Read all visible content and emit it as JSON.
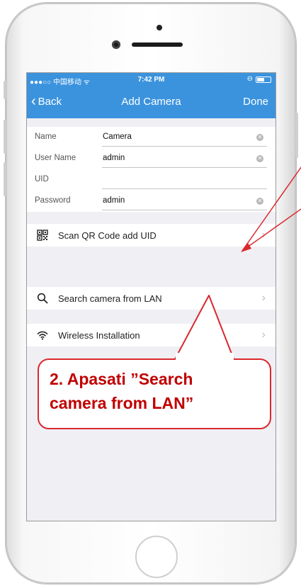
{
  "status_bar": {
    "carrier": "●●●○○ 中国移动 ᯤ",
    "time": "7:42 PM",
    "indicator": "⊖"
  },
  "nav": {
    "back_label": "Back",
    "title": "Add Camera",
    "done_label": "Done"
  },
  "form": {
    "fields": [
      {
        "label": "Name",
        "value": "Camera",
        "clear": true
      },
      {
        "label": "User Name",
        "value": "admin",
        "clear": true
      },
      {
        "label": "UID",
        "value": "",
        "clear": false
      },
      {
        "label": "Password",
        "value": "admin",
        "clear": true
      }
    ]
  },
  "actions": [
    {
      "label": "Scan QR Code add UID",
      "icon": "qr-code-icon"
    },
    {
      "label": "Search camera from LAN",
      "icon": "search-icon"
    },
    {
      "label": "Wireless Installation",
      "icon": "wifi-icon"
    }
  ],
  "annotation": {
    "line1": "2. Apasati ”Search",
    "line2": "camera from LAN”"
  },
  "colors": {
    "nav_blue": "#3b93de",
    "annotation_red": "#d9282f",
    "screen_bg": "#efeff4"
  }
}
